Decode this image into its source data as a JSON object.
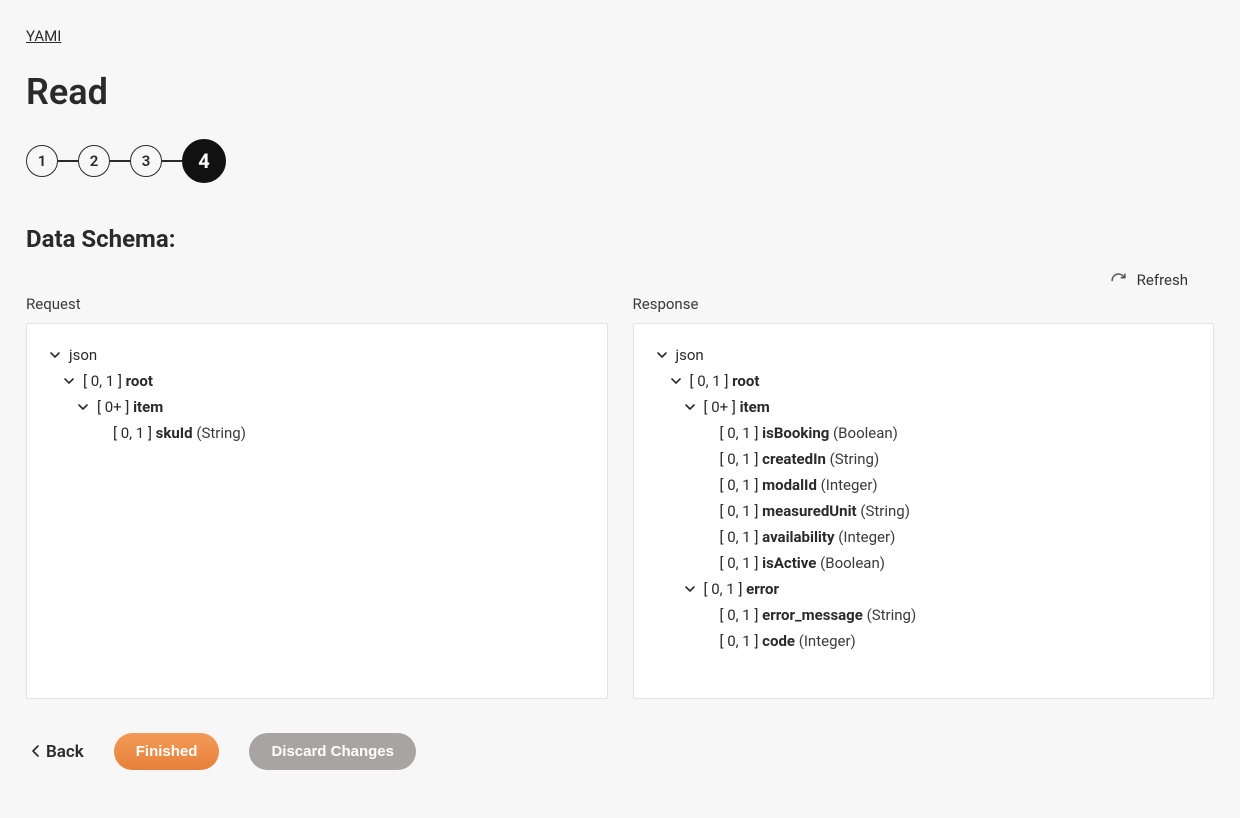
{
  "breadcrumb": {
    "label": "YAMI"
  },
  "page_title": "Read",
  "stepper": {
    "steps": [
      "1",
      "2",
      "3",
      "4"
    ],
    "active_index": 3
  },
  "section_title": "Data Schema:",
  "refresh_label": "Refresh",
  "panels": {
    "request": {
      "label": "Request",
      "tree": [
        {
          "indent": 0,
          "chevron": true,
          "card": "",
          "name": "json",
          "type": ""
        },
        {
          "indent": 1,
          "chevron": true,
          "card": "[ 0, 1 ]",
          "name": "root",
          "type": ""
        },
        {
          "indent": 2,
          "chevron": true,
          "card": "[ 0+ ]",
          "name": "item",
          "type": ""
        },
        {
          "indent": 3,
          "chevron": false,
          "card": "[ 0, 1 ]",
          "name": "skuId",
          "type": "(String)"
        }
      ]
    },
    "response": {
      "label": "Response",
      "tree": [
        {
          "indent": 0,
          "chevron": true,
          "card": "",
          "name": "json",
          "type": ""
        },
        {
          "indent": 1,
          "chevron": true,
          "card": "[ 0, 1 ]",
          "name": "root",
          "type": ""
        },
        {
          "indent": 2,
          "chevron": true,
          "card": "[ 0+ ]",
          "name": "item",
          "type": ""
        },
        {
          "indent": 3,
          "chevron": false,
          "card": "[ 0, 1 ]",
          "name": "isBooking",
          "type": "(Boolean)"
        },
        {
          "indent": 3,
          "chevron": false,
          "card": "[ 0, 1 ]",
          "name": "createdIn",
          "type": "(String)"
        },
        {
          "indent": 3,
          "chevron": false,
          "card": "[ 0, 1 ]",
          "name": "modalId",
          "type": "(Integer)"
        },
        {
          "indent": 3,
          "chevron": false,
          "card": "[ 0, 1 ]",
          "name": "measuredUnit",
          "type": "(String)"
        },
        {
          "indent": 3,
          "chevron": false,
          "card": "[ 0, 1 ]",
          "name": "availability",
          "type": "(Integer)"
        },
        {
          "indent": 3,
          "chevron": false,
          "card": "[ 0, 1 ]",
          "name": "isActive",
          "type": "(Boolean)"
        },
        {
          "indent": 2,
          "chevron": true,
          "card": "[ 0, 1 ]",
          "name": "error",
          "type": ""
        },
        {
          "indent": 3,
          "chevron": false,
          "card": "[ 0, 1 ]",
          "name": "error_message",
          "type": "(String)"
        },
        {
          "indent": 3,
          "chevron": false,
          "card": "[ 0, 1 ]",
          "name": "code",
          "type": "(Integer)"
        }
      ]
    }
  },
  "footer": {
    "back": "Back",
    "finished": "Finished",
    "discard": "Discard Changes"
  }
}
